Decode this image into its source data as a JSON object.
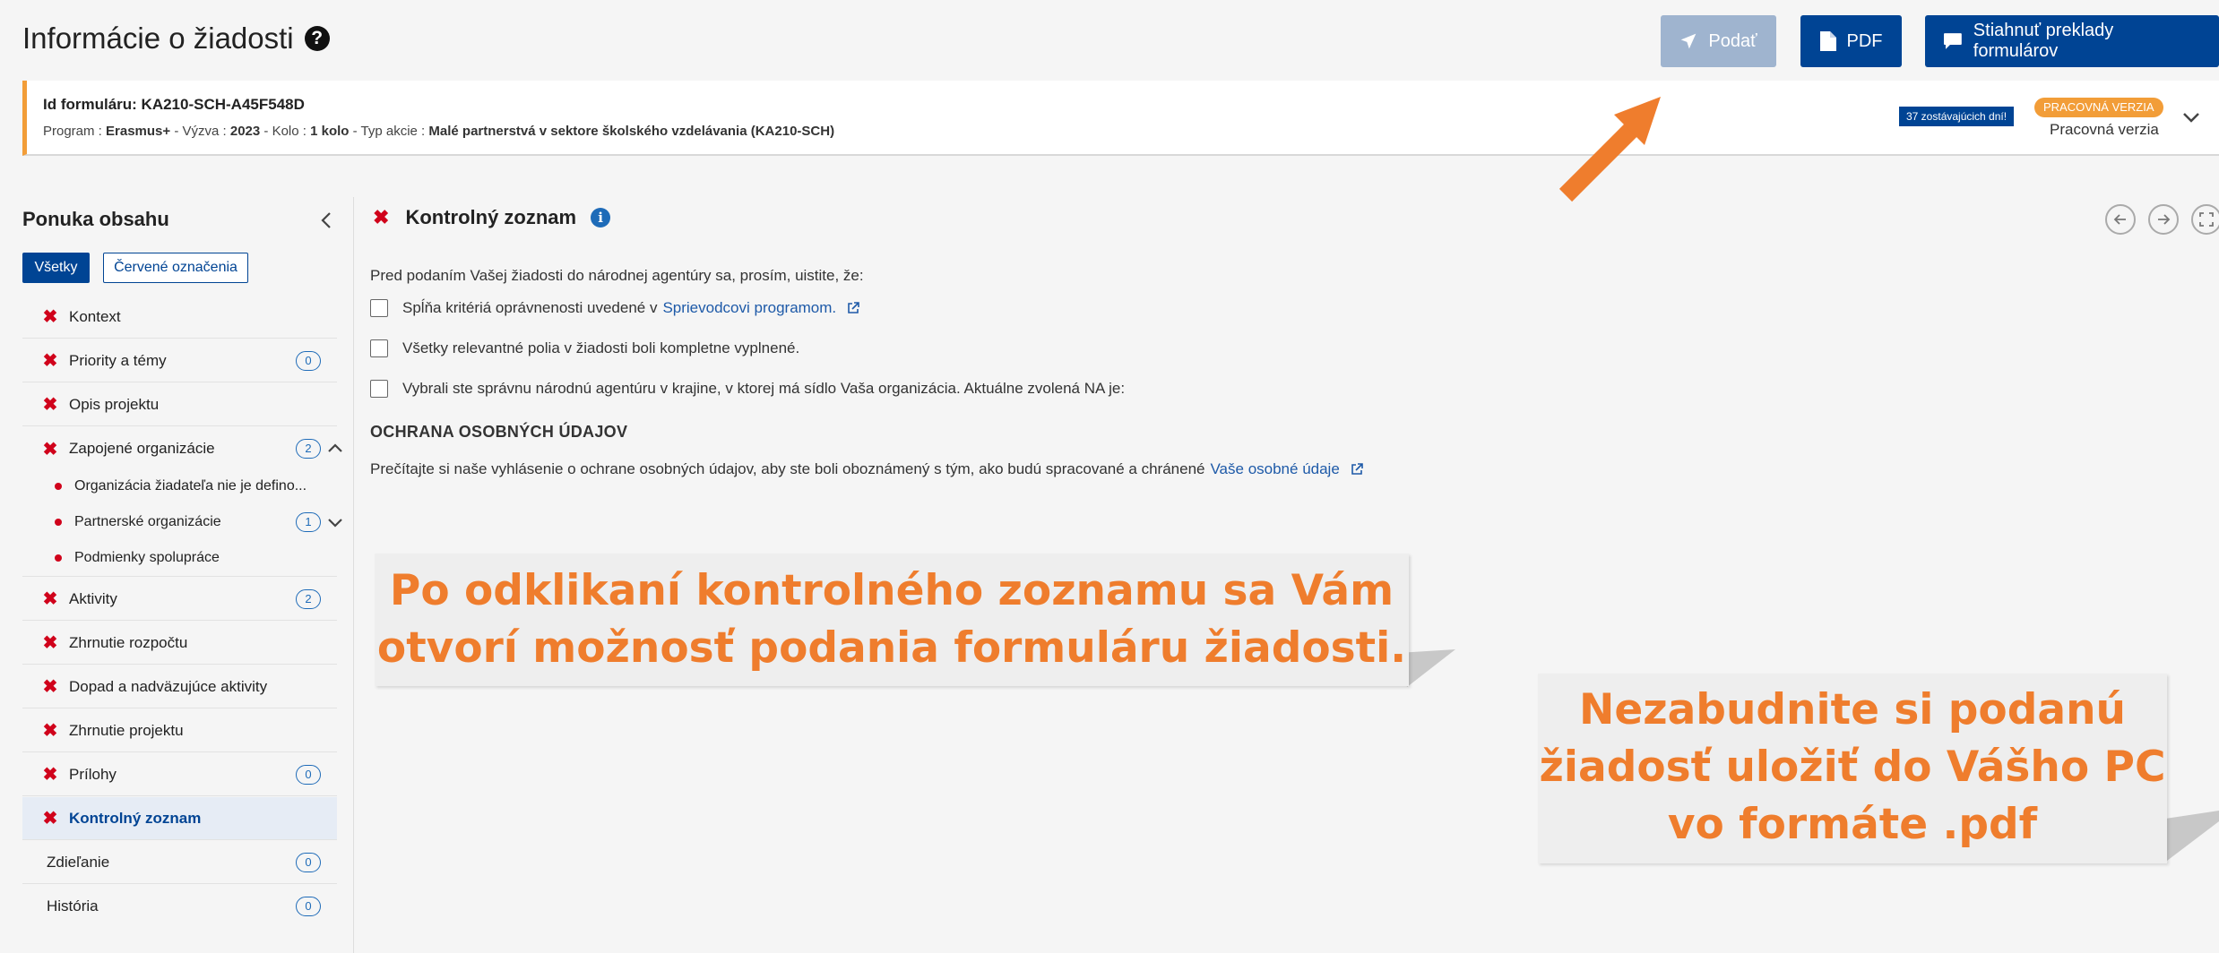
{
  "header": {
    "title": "Informácie o žiadosti",
    "submit_label": "Podať",
    "pdf_label": "PDF",
    "translations_label": "Stiahnuť preklady formulárov"
  },
  "info_bar": {
    "form_id_label": "Id formuláru: KA210-SCH-A45F548D",
    "meta": {
      "program_label": "Program : ",
      "program": "Erasmus+",
      "call_label": " - Výzva : ",
      "call": "2023",
      "round_label": " - Kolo : ",
      "round": "1 kolo",
      "action_label": " - Typ akcie : ",
      "action": "Malé partnerstvá v sektore školského vzdelávania (KA210-SCH)"
    },
    "days_badge": "37 zostávajúcich dní!",
    "version_badge": "PRACOVNÁ VERZIA",
    "version_label": "Pracovná verzia"
  },
  "sidebar": {
    "title": "Ponuka obsahu",
    "filter_all": "Všetky",
    "filter_red": "Červené označenia",
    "items": [
      {
        "label": "Kontext",
        "count": ""
      },
      {
        "label": "Priority a témy",
        "count": "0"
      },
      {
        "label": "Opis projektu",
        "count": ""
      },
      {
        "label": "Zapojené organizácie",
        "count": "2"
      },
      {
        "label": "Aktivity",
        "count": "2"
      },
      {
        "label": "Zhrnutie rozpočtu",
        "count": ""
      },
      {
        "label": "Dopad a nadväzujúce aktivity",
        "count": ""
      },
      {
        "label": "Zhrnutie projektu",
        "count": ""
      },
      {
        "label": "Prílohy",
        "count": "0"
      },
      {
        "label": "Kontrolný zoznam",
        "count": ""
      },
      {
        "label": "Zdieľanie",
        "count": "0"
      },
      {
        "label": "História",
        "count": "0"
      }
    ],
    "subitems": [
      {
        "label": "Organizácia žiadateľa nie je defino...",
        "count": ""
      },
      {
        "label": "Partnerské organizácie",
        "count": "1"
      },
      {
        "label": "Podmienky spolupráce",
        "count": ""
      }
    ]
  },
  "main": {
    "title": "Kontrolný zoznam",
    "intro": "Pred podaním Vašej žiadosti do národnej agentúry sa, prosím, uistite, že:",
    "check1_text": "Spĺňa kritériá oprávnenosti uvedené v",
    "check1_link": "Sprievodcovi programom.",
    "check2_text": "Všetky relevantné polia v žiadosti boli kompletne vyplnené.",
    "check3_text": "Vybrali ste správnu národnú agentúru v krajine, v ktorej má sídlo Vaša organizácia. Aktuálne zvolená NA je:",
    "privacy_title": "OCHRANA OSOBNÝCH ÚDAJOV",
    "privacy_text": "Prečítajte si naše vyhlásenie o ochrane osobných údajov, aby ste boli oboznámený s tým, ako budú spracované a chránené",
    "privacy_link": "Vaše osobné údaje"
  },
  "callouts": {
    "first_line1": "Po odklikaní kontrolného zoznamu sa Vám",
    "first_line2": "otvorí možnosť podania formuláru žiadosti.",
    "second_line1": "Nezabudnite si podanú",
    "second_line2": "žiadosť uložiť do Vášho PC",
    "second_line3": "vo formáte .pdf"
  },
  "colors": {
    "primary": "#004494",
    "submit_disabled": "#9fb4cf",
    "accent_orange": "#ef7d2d",
    "error_red": "#d0021b",
    "badge_orange": "#f29d38"
  }
}
